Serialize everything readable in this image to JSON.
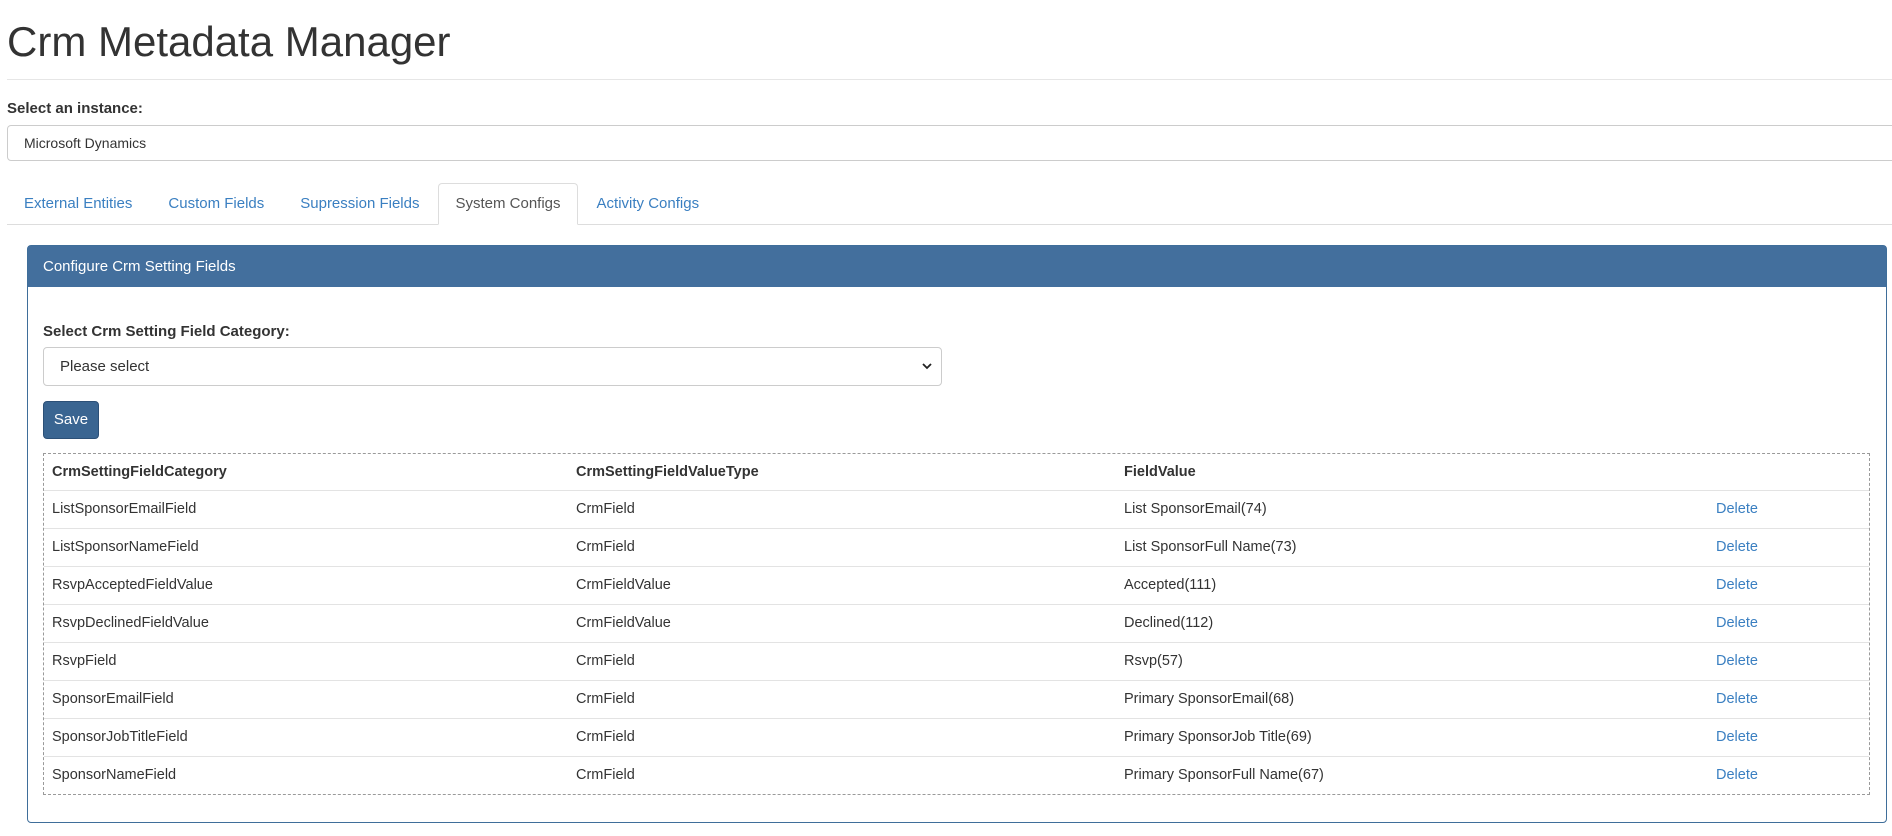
{
  "page": {
    "title": "Crm Metadata Manager"
  },
  "instance": {
    "label": "Select an instance:",
    "value": "Microsoft Dynamics"
  },
  "tabs": [
    {
      "label": "External Entities"
    },
    {
      "label": "Custom Fields"
    },
    {
      "label": "Supression Fields"
    },
    {
      "label": "System Configs",
      "active": true
    },
    {
      "label": "Activity Configs"
    }
  ],
  "panel": {
    "heading": "Configure Crm Setting Fields",
    "category_label": "Select Crm Setting Field Category:",
    "category_select": {
      "value": "Please select"
    },
    "save_label": "Save"
  },
  "table": {
    "columns": [
      "CrmSettingFieldCategory",
      "CrmSettingFieldValueType",
      "FieldValue",
      ""
    ],
    "rows": [
      {
        "category": "ListSponsorEmailField",
        "value_type": "CrmField",
        "field_value": "List SponsorEmail(74)",
        "action": "Delete"
      },
      {
        "category": "ListSponsorNameField",
        "value_type": "CrmField",
        "field_value": "List SponsorFull Name(73)",
        "action": "Delete"
      },
      {
        "category": "RsvpAcceptedFieldValue",
        "value_type": "CrmFieldValue",
        "field_value": "Accepted(111)",
        "action": "Delete"
      },
      {
        "category": "RsvpDeclinedFieldValue",
        "value_type": "CrmFieldValue",
        "field_value": "Declined(112)",
        "action": "Delete"
      },
      {
        "category": "RsvpField",
        "value_type": "CrmField",
        "field_value": "Rsvp(57)",
        "action": "Delete"
      },
      {
        "category": "SponsorEmailField",
        "value_type": "CrmField",
        "field_value": "Primary SponsorEmail(68)",
        "action": "Delete"
      },
      {
        "category": "SponsorJobTitleField",
        "value_type": "CrmField",
        "field_value": "Primary SponsorJob Title(69)",
        "action": "Delete"
      },
      {
        "category": "SponsorNameField",
        "value_type": "CrmField",
        "field_value": "Primary SponsorFull Name(67)",
        "action": "Delete"
      }
    ]
  },
  "colors": {
    "panel_heading": "#436f9d",
    "link": "#3a7fc1",
    "button": "#3a6591"
  }
}
